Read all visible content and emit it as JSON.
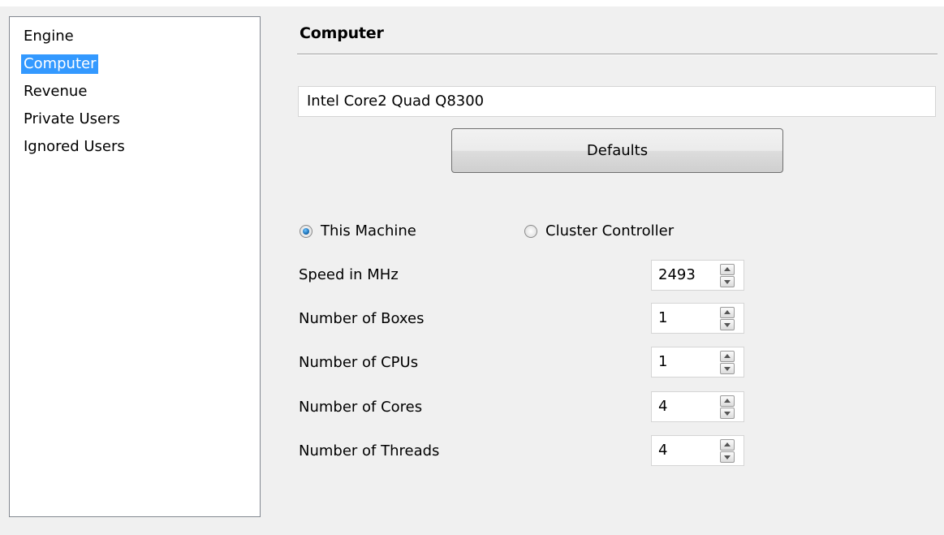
{
  "nav": {
    "items": [
      {
        "label": "Engine",
        "selected": false
      },
      {
        "label": "Computer",
        "selected": true
      },
      {
        "label": "Revenue",
        "selected": false
      },
      {
        "label": "Private Users",
        "selected": false
      },
      {
        "label": "Ignored Users",
        "selected": false
      }
    ]
  },
  "section": {
    "title": "Computer",
    "cpu_name": "Intel Core2 Quad Q8300",
    "defaults_label": "Defaults"
  },
  "mode": {
    "options": [
      {
        "label": "This Machine",
        "checked": true
      },
      {
        "label": "Cluster Controller",
        "checked": false
      }
    ]
  },
  "fields": [
    {
      "label": "Speed in MHz",
      "value": "2493"
    },
    {
      "label": "Number of Boxes",
      "value": "1"
    },
    {
      "label": "Number of CPUs",
      "value": "1"
    },
    {
      "label": "Number of Cores",
      "value": "4"
    },
    {
      "label": "Number of Threads",
      "value": "4"
    }
  ]
}
